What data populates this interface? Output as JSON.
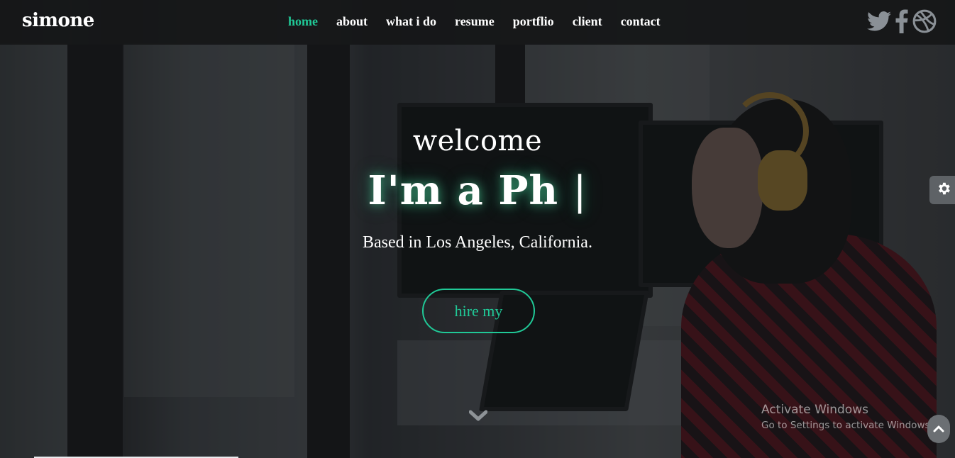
{
  "header": {
    "logo": "simone",
    "nav": [
      {
        "label": "home",
        "active": true
      },
      {
        "label": "about",
        "active": false
      },
      {
        "label": "what i do",
        "active": false
      },
      {
        "label": "resume",
        "active": false
      },
      {
        "label": "portflio",
        "active": false
      },
      {
        "label": "client",
        "active": false
      },
      {
        "label": "contact",
        "active": false
      }
    ],
    "social_icons": [
      "twitter-icon",
      "facebook-icon",
      "dribbble-icon"
    ]
  },
  "hero": {
    "welcome": "welcome",
    "typed_text": "I'm a Ph",
    "cursor": "|",
    "location": "Based in Los Angeles, California.",
    "cta_label": "hire my",
    "scroll_icon": "chevron-down-icon"
  },
  "widgets": {
    "settings_icon": "gear-icon",
    "back_to_top_icon": "chevron-up-icon"
  },
  "watermark": {
    "title": "Activate Windows",
    "subtitle": "Go to Settings to activate Windows."
  },
  "colors": {
    "accent": "#20c997",
    "header_bg": "#161718",
    "text": "#ffffff"
  }
}
